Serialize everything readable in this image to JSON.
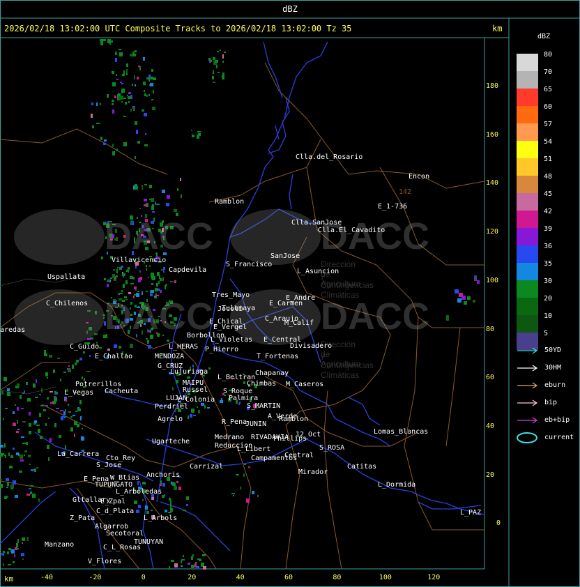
{
  "window_title": "dBZ",
  "header": {
    "text": "2026/02/18 13:02:00 UTC Composite Tracks to 2026/02/18 13:02:00 Tz 35",
    "km_top": "km",
    "km_bottom": "km"
  },
  "y_axis": {
    "ticks": [
      "180",
      "160",
      "140",
      "120",
      "100",
      "80",
      "60",
      "40",
      "20",
      "0"
    ]
  },
  "x_axis": {
    "ticks": [
      "-40",
      "-20",
      "0",
      "20",
      "40",
      "60",
      "80",
      "100",
      "120"
    ]
  },
  "scale": {
    "title": "dBZ",
    "levels": [
      {
        "value": "80",
        "color": "#d8d8d8"
      },
      {
        "value": "70",
        "color": "#b4b4b4"
      },
      {
        "value": "65",
        "color": "#ff3a2a"
      },
      {
        "value": "60",
        "color": "#ff6a10"
      },
      {
        "value": "57",
        "color": "#ff9a50"
      },
      {
        "value": "54",
        "color": "#ffff10"
      },
      {
        "value": "51",
        "color": "#ffc828"
      },
      {
        "value": "48",
        "color": "#d8883c"
      },
      {
        "value": "45",
        "color": "#c86aa0"
      },
      {
        "value": "42",
        "color": "#d01890"
      },
      {
        "value": "39",
        "color": "#8818d8"
      },
      {
        "value": "36",
        "color": "#2848f0"
      },
      {
        "value": "35",
        "color": "#1488e0"
      },
      {
        "value": "30",
        "color": "#0c8820"
      },
      {
        "value": "20",
        "color": "#0a6810"
      },
      {
        "value": "10",
        "color": "#0c5810"
      },
      {
        "value": "5",
        "color": "#48408c"
      }
    ]
  },
  "legend": [
    {
      "label": "50YD",
      "color": "#40e0e0",
      "kind": "arrow"
    },
    {
      "label": "30HM",
      "color": "#ffffff",
      "kind": "arrow"
    },
    {
      "label": "eburn",
      "color": "#d8b070",
      "kind": "arrow"
    },
    {
      "label": "bip",
      "color": "#ffc8d8",
      "kind": "arrow"
    },
    {
      "label": "eb+bip",
      "color": "#e040e0",
      "kind": "arrow"
    },
    {
      "label": "current",
      "color": "#40e0e0",
      "kind": "ellipse"
    }
  ],
  "watermark": {
    "text": "DACC",
    "subtitle_1": "Dirección de Agricultura",
    "subtitle_2": "y Contingencias Climáticas"
  },
  "places": [
    "Clla.del_Rosario",
    "Encon",
    "142",
    "E_1-736",
    "Ramblon",
    "Clla.SanJose",
    "Clla.El_Cavadito",
    "Villavicencio",
    "Capdevila",
    "S_Francisco",
    "SanJose",
    "L_Asuncion",
    "Uspallata",
    "Tres_Mayo",
    "Jocoli",
    "Tulumaya",
    "E_Carmen",
    "C_Chilenos",
    "E_Andre",
    "C_Araujo",
    "E_Chical",
    "E_Vergel",
    "M_Calif",
    "aredas",
    "Borbollon",
    "E_Central",
    "Divisadero",
    "L_Violetas",
    "C_Guido",
    "L_HERAS",
    "P_Hierro",
    "E_Challao",
    "MENDOZA",
    "T_Fortenas",
    "G_CRUZ",
    "Lujuriaga",
    "Chapanay",
    "L_Beltran",
    "MAIPU",
    "Chimbas",
    "M_Caseros",
    "Potrerillos",
    "Cacheuta",
    "Russel",
    "S_Roque",
    "L_Vegas",
    "LUJAN",
    "L_Colonia",
    "Palmira",
    "Perdriel",
    "S_MARTIN",
    "A_Verde",
    "Agrelo",
    "R_Pena",
    "JUNIN",
    "Ramblon",
    "Lomas_Blancas",
    "Ugarteche",
    "Medrano",
    "RIVADAVIA",
    "12_Oct",
    "Phillips",
    "Reduccion",
    "S_ROSA",
    "La_Carrera",
    "Cto_Rey",
    "L_Libert",
    "Carrizal",
    "Campamentos",
    "Central",
    "S_Jose",
    "Catitas",
    "Anchoris",
    "Mirador",
    "E_Pena",
    "W_Btias",
    "TUPUNGATO",
    "L_Dormida",
    "L_Arboledas",
    "Gltallary",
    "E_Zpal",
    "C_d_Plata",
    "L_Arbols",
    "Z_Pata",
    "L_PAZ",
    "Algarrob",
    "Secotoral",
    "Manzano",
    "TUNUYAN",
    "C_L_Rosas",
    "V_Flores"
  ]
}
